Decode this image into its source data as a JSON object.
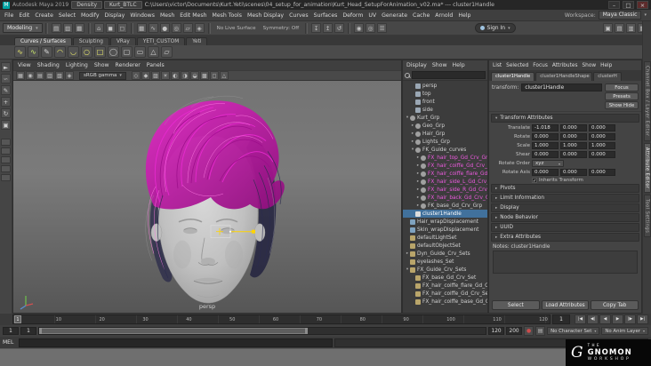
{
  "colors": {
    "selection_blue": "#41719c",
    "outliner_magenta": "#ee5ae0",
    "hair_magenta": "#d923bd",
    "manipulator_yellow": "#ffd400",
    "maya_badge_teal": "#00a3a3"
  },
  "titlebar": {
    "app": "Autodesk Maya 2019",
    "tabs": [
      {
        "label": "Density"
      },
      {
        "label": "Kurt_BTLC"
      }
    ],
    "title": "C:\\Users\\victor\\Documents\\Kurt.Yeti\\scenes\\04_setup_for_animation\\Kurt_Head_SetupForAnimation_v02.ma* --- cluster1Handle",
    "minimize": "–",
    "maximize": "□",
    "close": "×"
  },
  "menubar": {
    "items": [
      {
        "label": "File"
      },
      {
        "label": "Edit"
      },
      {
        "label": "Create"
      },
      {
        "label": "Select"
      },
      {
        "label": "Modify"
      },
      {
        "label": "Display"
      },
      {
        "label": "Windows"
      },
      {
        "label": "Mesh"
      },
      {
        "label": "Edit Mesh"
      },
      {
        "label": "Mesh Tools"
      },
      {
        "label": "Mesh Display"
      },
      {
        "label": "Curves"
      },
      {
        "label": "Surfaces"
      },
      {
        "label": "Deform"
      },
      {
        "label": "UV"
      },
      {
        "label": "Generate"
      },
      {
        "label": "Cache"
      },
      {
        "label": "Arnold"
      },
      {
        "label": "Help"
      }
    ],
    "workspace_label": "Workspace:",
    "workspace_value": "Maya Classic",
    "caret": "▾"
  },
  "statusline": {
    "menuset": "Modeling",
    "menuset_caret": "▾",
    "file_icons": [
      {
        "n": "new-scene-icon",
        "g": "▤"
      },
      {
        "n": "open-scene-icon",
        "g": "▥"
      },
      {
        "n": "save-scene-icon",
        "g": "▦"
      }
    ],
    "select_icons": [
      {
        "n": "select-hierarchy-icon",
        "g": "⌂"
      },
      {
        "n": "select-object-icon",
        "g": "◼"
      },
      {
        "n": "select-component-icon",
        "g": "◻"
      }
    ],
    "snap_icons": [
      {
        "n": "snap-grid-icon",
        "g": "▦"
      },
      {
        "n": "snap-curve-icon",
        "g": "∿"
      },
      {
        "n": "snap-point-icon",
        "g": "●"
      },
      {
        "n": "snap-projected-center-icon",
        "g": "◎"
      },
      {
        "n": "snap-view-plane-icon",
        "g": "▱"
      },
      {
        "n": "make-live-icon",
        "g": "◈"
      }
    ],
    "live_surface_label": "No Live Surface",
    "symmetry_label": "Symmetry: Off",
    "history_icons": [
      {
        "n": "input-connections-icon",
        "g": "↧"
      },
      {
        "n": "output-connections-icon",
        "g": "↥"
      },
      {
        "n": "construction-history-icon",
        "g": "↺"
      }
    ],
    "render_icons": [
      {
        "n": "render-view-icon",
        "g": "◉"
      },
      {
        "n": "ipr-render-icon",
        "g": "◎"
      },
      {
        "n": "render-settings-icon",
        "g": "☰"
      }
    ],
    "signin_label": "Sign In",
    "signin_caret": "▾",
    "right_icons": [
      {
        "n": "toggle-modeling-toolkit-icon",
        "g": "▣"
      },
      {
        "n": "toggle-attribute-editor-icon",
        "g": "▤"
      },
      {
        "n": "toggle-tool-settings-icon",
        "g": "▥"
      },
      {
        "n": "toggle-channel-box-icon",
        "g": "▦"
      }
    ]
  },
  "shelf": {
    "tabs": [
      {
        "label": "Curves / Surfaces",
        "cls": "active"
      },
      {
        "label": "Sculpting",
        "cls": ""
      },
      {
        "label": "VRay",
        "cls": ""
      },
      {
        "label": "YETI_CUSTOM",
        "cls": ""
      },
      {
        "label": "Yeti",
        "cls": ""
      }
    ],
    "icons": [
      {
        "n": "cv-curve-tool-icon",
        "g": "∿",
        "c": "#e8e86a"
      },
      {
        "n": "ep-curve-tool-icon",
        "g": "∿",
        "c": "#c9e86a"
      },
      {
        "n": "pencil-curve-tool-icon",
        "g": "✎",
        "c": "#d8d8d8"
      },
      {
        "n": "three-point-arc-icon",
        "g": "◠",
        "c": "#e8e86a"
      },
      {
        "n": "two-point-arc-icon",
        "g": "◡",
        "c": "#e8e86a"
      },
      {
        "n": "nurbs-circle-icon",
        "g": "○",
        "c": "#e8e86a"
      },
      {
        "n": "nurbs-square-icon",
        "g": "□",
        "c": "#e8e86a"
      },
      {
        "n": "nurbs-sphere-icon",
        "g": "◯",
        "c": "#cfcfcf"
      },
      {
        "n": "nurbs-cube-icon",
        "g": "▢",
        "c": "#cfcfcf"
      },
      {
        "n": "nurbs-cylinder-icon",
        "g": "▭",
        "c": "#cfcfcf"
      },
      {
        "n": "nurbs-cone-icon",
        "g": "△",
        "c": "#cfcfcf"
      },
      {
        "n": "nurbs-plane-icon",
        "g": "▱",
        "c": "#cfcfcf"
      }
    ]
  },
  "toolbox": {
    "tools": [
      {
        "n": "select-tool-icon",
        "g": "►"
      },
      {
        "n": "lasso-select-tool-icon",
        "g": "∽"
      },
      {
        "n": "paint-select-tool-icon",
        "g": "✎"
      },
      {
        "n": "move-tool-icon",
        "g": "+"
      },
      {
        "n": "rotate-tool-icon",
        "g": "↻"
      },
      {
        "n": "scale-tool-icon",
        "g": "▣"
      }
    ],
    "layouts": [
      {
        "n": "layout-single-pane-button"
      },
      {
        "n": "layout-four-pane-button"
      },
      {
        "n": "layout-persp-outliner-button"
      },
      {
        "n": "layout-two-pane-button"
      },
      {
        "n": "layout-persp-graph-button"
      }
    ]
  },
  "viewport": {
    "menus": [
      {
        "label": "View"
      },
      {
        "label": "Shading"
      },
      {
        "label": "Lighting"
      },
      {
        "label": "Show"
      },
      {
        "label": "Renderer"
      },
      {
        "label": "Panels"
      }
    ],
    "left_icons": [
      {
        "n": "select-camera-icon",
        "g": "▦"
      },
      {
        "n": "lock-camera-icon",
        "g": "◉"
      },
      {
        "n": "camera-attributes-icon",
        "g": "▤"
      },
      {
        "n": "bookmarks-icon",
        "g": "▥"
      },
      {
        "n": "image-plane-icon",
        "g": "▧"
      },
      {
        "n": "two-d-pan-zoom-icon",
        "g": "◈"
      }
    ],
    "gamma_label": "sRGB gamma",
    "gamma_caret": "▾",
    "right_icons": [
      {
        "n": "wireframe-icon",
        "g": "◇"
      },
      {
        "n": "shaded-icon",
        "g": "◆"
      },
      {
        "n": "textured-icon",
        "g": "▨"
      },
      {
        "n": "use-all-lights-icon",
        "g": "☀"
      },
      {
        "n": "shadows-icon",
        "g": "◐"
      },
      {
        "n": "ambient-occlusion-icon",
        "g": "◑"
      },
      {
        "n": "motion-blur-icon",
        "g": "◒"
      },
      {
        "n": "anti-aliasing-icon",
        "g": "▩"
      },
      {
        "n": "isolate-select-icon",
        "g": "◻"
      },
      {
        "n": "x-ray-icon",
        "g": "△"
      }
    ],
    "camera_label": "persp"
  },
  "outliner": {
    "menus": [
      {
        "label": "Display"
      },
      {
        "label": "Show"
      },
      {
        "label": "Help"
      }
    ],
    "items": [
      {
        "label": "persp",
        "pad": "8px",
        "icon": "ic-camera",
        "arrow": "",
        "cls": ""
      },
      {
        "label": "top",
        "pad": "8px",
        "icon": "ic-camera",
        "arrow": "",
        "cls": ""
      },
      {
        "label": "front",
        "pad": "8px",
        "icon": "ic-camera",
        "arrow": "",
        "cls": ""
      },
      {
        "label": "side",
        "pad": "8px",
        "icon": "ic-camera",
        "arrow": "",
        "cls": ""
      },
      {
        "label": "Kurt_Grp",
        "pad": "2px",
        "icon": "ic-group",
        "arrow": "▾",
        "cls": ""
      },
      {
        "label": "Geo_Grp",
        "pad": "8px",
        "icon": "ic-group",
        "arrow": "▸",
        "cls": ""
      },
      {
        "label": "Hair_Grp",
        "pad": "8px",
        "icon": "ic-group",
        "arrow": "▸",
        "cls": ""
      },
      {
        "label": "Lights_Grp",
        "pad": "8px",
        "icon": "ic-group",
        "arrow": "▸",
        "cls": ""
      },
      {
        "label": "FK_Guide_curves",
        "pad": "8px",
        "icon": "ic-group",
        "arrow": "▾",
        "cls": ""
      },
      {
        "label": "FX_hair_top_Gd_Crv_Grp",
        "pad": "14px",
        "icon": "ic-group",
        "arrow": "▸",
        "cls": "magenta"
      },
      {
        "label": "FX_hair_coiffe_Gd_Crv_Grp",
        "pad": "14px",
        "icon": "ic-group",
        "arrow": "▸",
        "cls": "magenta"
      },
      {
        "label": "FX_hair_coiffe_flare_Gd_Crv_Grp",
        "pad": "14px",
        "icon": "ic-group",
        "arrow": "▸",
        "cls": "magenta"
      },
      {
        "label": "FX_hair_side_L_Gd_Crv_Grp",
        "pad": "14px",
        "icon": "ic-group",
        "arrow": "▸",
        "cls": "magenta"
      },
      {
        "label": "FX_hair_side_R_Gd_Crv_Grp",
        "pad": "14px",
        "icon": "ic-group",
        "arrow": "▸",
        "cls": "magenta"
      },
      {
        "label": "FX_hair_back_Gd_Crv_Grp",
        "pad": "14px",
        "icon": "ic-group",
        "arrow": "▸",
        "cls": "magenta"
      },
      {
        "label": "FK_base_Gd_Crv_Grp",
        "pad": "14px",
        "icon": "ic-group",
        "arrow": "▸",
        "cls": ""
      },
      {
        "label": "cluster1Handle",
        "pad": "8px",
        "icon": "ic-cluster",
        "arrow": "",
        "cls": "selected"
      },
      {
        "label": "Hair_wrapDisplacement",
        "pad": "2px",
        "icon": "ic-deformer",
        "arrow": "",
        "cls": ""
      },
      {
        "label": "Skin_wrapDisplacement",
        "pad": "2px",
        "icon": "ic-deformer",
        "arrow": "",
        "cls": ""
      },
      {
        "label": "defaultLightSet",
        "pad": "2px",
        "icon": "ic-set",
        "arrow": "",
        "cls": ""
      },
      {
        "label": "defaultObjectSet",
        "pad": "2px",
        "icon": "ic-set",
        "arrow": "",
        "cls": ""
      },
      {
        "label": "Dyn_Guide_Crv_Sets",
        "pad": "2px",
        "icon": "ic-set",
        "arrow": "▸",
        "cls": ""
      },
      {
        "label": "eyelashes_Set",
        "pad": "2px",
        "icon": "ic-set",
        "arrow": "",
        "cls": ""
      },
      {
        "label": "FX_Guide_Crv_Sets",
        "pad": "2px",
        "icon": "ic-set",
        "arrow": "▾",
        "cls": ""
      },
      {
        "label": "FX_base_Gd_Crv_Set",
        "pad": "8px",
        "icon": "ic-set",
        "arrow": "",
        "cls": ""
      },
      {
        "label": "FX_hair_coiffe_flare_Gd_Crv_Set",
        "pad": "8px",
        "icon": "ic-set",
        "arrow": "",
        "cls": ""
      },
      {
        "label": "FX_hair_coiffe_Gd_Crv_Set",
        "pad": "8px",
        "icon": "ic-set",
        "arrow": "",
        "cls": ""
      },
      {
        "label": "FX_hair_coiffe_base_Gd_Crv_Set",
        "pad": "8px",
        "icon": "ic-set",
        "arrow": "",
        "cls": ""
      }
    ]
  },
  "attr_editor": {
    "menus": [
      {
        "label": "List"
      },
      {
        "label": "Selected"
      },
      {
        "label": "Focus"
      },
      {
        "label": "Attributes"
      },
      {
        "label": "Show"
      },
      {
        "label": "Help"
      }
    ],
    "tabs": [
      {
        "label": "cluster1Handle",
        "cls": "active"
      },
      {
        "label": "cluster1HandleShape",
        "cls": ""
      },
      {
        "label": "clusterH",
        "cls": ""
      }
    ],
    "node_type_label": "transform:",
    "node_name": "cluster1Handle",
    "focus_label": "Focus",
    "presets_label": "Presets",
    "showhide_label": "Show Hide",
    "transform_section_title": "Transform Attributes",
    "transform_rows": [
      {
        "label": "Translate",
        "v0": "-1.018",
        "v1": "0.000",
        "v2": "0.000"
      },
      {
        "label": "Rotate",
        "v0": "0.000",
        "v1": "0.000",
        "v2": "0.000"
      },
      {
        "label": "Scale",
        "v0": "1.000",
        "v1": "1.000",
        "v2": "1.000"
      },
      {
        "label": "Shear",
        "v0": "0.000",
        "v1": "0.000",
        "v2": "0.000"
      }
    ],
    "rotate_order_label": "Rotate Order",
    "rotate_order_value": "xyz",
    "rotate_axis_label": "Rotate Axis",
    "rotate_axis": {
      "v0": "0.000",
      "v1": "0.000",
      "v2": "0.000"
    },
    "inherits_label": "Inherits Transform",
    "inherits_check": "✓",
    "collapsed_sections": [
      {
        "label": "Pivots"
      },
      {
        "label": "Limit Information"
      },
      {
        "label": "Display"
      },
      {
        "label": "Node Behavior"
      },
      {
        "label": "UUID"
      },
      {
        "label": "Extra Attributes"
      }
    ],
    "notes_label": "Notes: cluster1Handle",
    "footer_buttons": [
      {
        "label": "Select",
        "n": "select-button"
      },
      {
        "label": "Load Attributes",
        "n": "load-attributes-button"
      },
      {
        "label": "Copy Tab",
        "n": "copy-tab-button"
      }
    ]
  },
  "right_strip": {
    "tabs": [
      {
        "label": "Channel Box / Layer Editor",
        "cls": ""
      },
      {
        "label": "Attribute Editor",
        "cls": "active"
      },
      {
        "label": "Tool Settings",
        "cls": ""
      }
    ]
  },
  "timeline": {
    "ticks": [
      "1",
      "10",
      "20",
      "30",
      "40",
      "50",
      "60",
      "70",
      "80",
      "90",
      "100",
      "110",
      "120"
    ],
    "current_frame": "1",
    "controls": [
      {
        "n": "go-to-start-button",
        "g": "|◀"
      },
      {
        "n": "step-back-frame-button",
        "g": "◀|"
      },
      {
        "n": "play-backwards-button",
        "g": "◀"
      },
      {
        "n": "play-forwards-button",
        "g": "▶"
      },
      {
        "n": "step-forward-frame-button",
        "g": "|▶"
      },
      {
        "n": "go-to-end-button",
        "g": "▶|"
      }
    ]
  },
  "range_bar": {
    "start": "1",
    "play_start": "1",
    "play_end": "120",
    "end": "200",
    "icons": [
      {
        "n": "auto-key-icon",
        "g": "●",
        "c": "#cc4c4c"
      },
      {
        "n": "animation-preferences-icon",
        "g": "▤",
        "c": "#bdbdbd"
      }
    ],
    "char_set": "No Character Set",
    "anim_layer": "No Anim Layer",
    "caret": "▾"
  },
  "command_line": {
    "label": "MEL"
  },
  "help_line": {
    "text": ""
  },
  "gnomon": {
    "the": "THE",
    "name": "GNOMON",
    "sub": "WORKSHOP"
  }
}
